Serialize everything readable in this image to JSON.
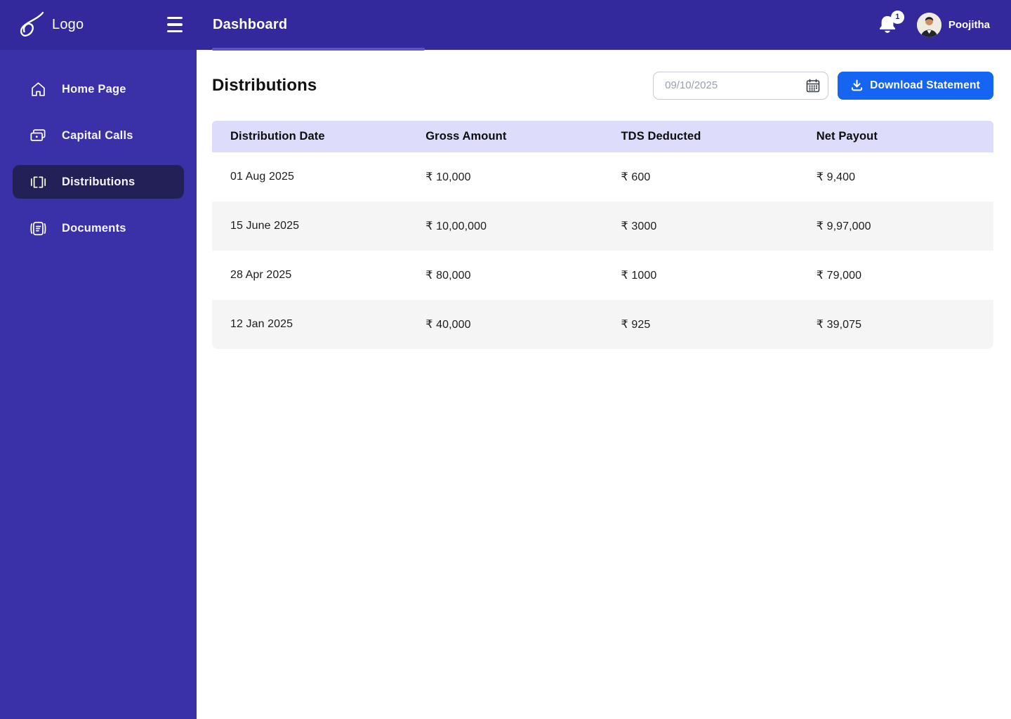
{
  "header": {
    "logo_text": "Logo",
    "title": "Dashboard",
    "notification_count": "1",
    "user_name": "Poojitha"
  },
  "sidebar": {
    "items": [
      {
        "label": "Home Page",
        "icon": "home-icon",
        "active": false
      },
      {
        "label": "Capital Calls",
        "icon": "cash-icon",
        "active": false
      },
      {
        "label": "Distributions",
        "icon": "distribution-icon",
        "active": true
      },
      {
        "label": "Documents",
        "icon": "document-icon",
        "active": false
      }
    ]
  },
  "main": {
    "page_title": "Distributions",
    "date_input": {
      "placeholder": "09/10/2025"
    },
    "download_button_label": "Download Statement",
    "table": {
      "columns": [
        "Distribution Date",
        "Gross Amount",
        "TDS Deducted",
        "Net Payout"
      ],
      "rows": [
        [
          "01 Aug 2025",
          "₹ 10,000",
          "₹ 600",
          "₹ 9,400"
        ],
        [
          "15 June 2025",
          "₹ 10,00,000",
          "₹ 3000",
          "₹ 9,97,000"
        ],
        [
          "28 Apr 2025",
          "₹ 80,000",
          "₹ 1000",
          "₹ 79,000"
        ],
        [
          "12 Jan 2025",
          "₹ 40,000",
          "₹ 925",
          "₹ 39,075"
        ]
      ]
    }
  },
  "colors": {
    "header_bg": "#33299C",
    "sidebar_bg": "#3A31A8",
    "active_item_bg": "#232058",
    "accent_blue": "#1565F2",
    "table_header_bg": "#DDDCFA",
    "row_alt_bg": "#F5F5F5",
    "tab_indicator": "#5B53C6"
  }
}
